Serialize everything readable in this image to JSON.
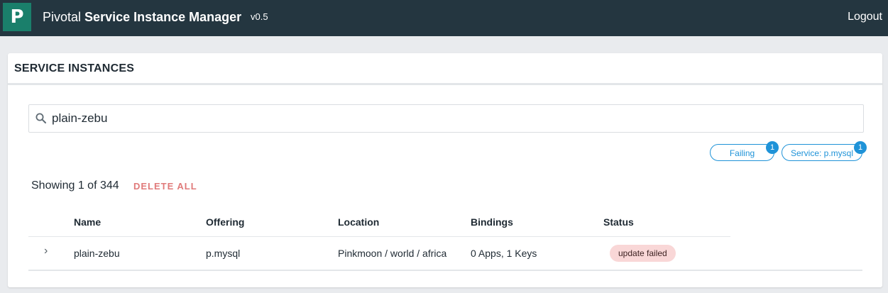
{
  "header": {
    "logo_letter": "P",
    "brand": "Pivotal",
    "product": "Service Instance Manager",
    "version": "v0.5",
    "logout_label": "Logout"
  },
  "card": {
    "title": "SERVICE INSTANCES"
  },
  "search": {
    "value": "plain-zebu",
    "icon": "search-icon"
  },
  "filters": [
    {
      "label": "Failing",
      "count": "1"
    },
    {
      "label": "Service: p.mysql",
      "count": "1"
    }
  ],
  "summary": {
    "showing_text": "Showing 1 of 344",
    "delete_all_label": "DELETE ALL"
  },
  "table": {
    "columns": [
      "Name",
      "Offering",
      "Location",
      "Bindings",
      "Status"
    ],
    "rows": [
      {
        "expand_icon": "chevron-right-icon",
        "name": "plain-zebu",
        "offering": "p.mysql",
        "location": "Pinkmoon / world / africa",
        "bindings": "0 Apps, 1 Keys",
        "status": "update failed"
      }
    ]
  },
  "colors": {
    "topbar": "#243640",
    "logo": "#1a7f6b",
    "accent": "#1f93d8",
    "danger_text": "#e07a7a",
    "status_failed_bg": "#f9d7d7"
  }
}
